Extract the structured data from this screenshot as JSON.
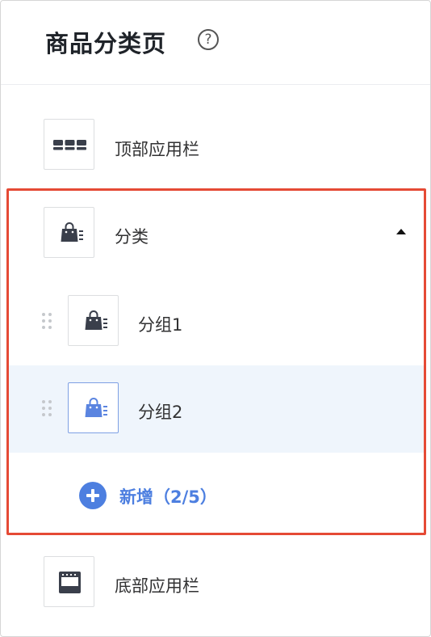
{
  "header": {
    "title": "商品分类页",
    "help_glyph": "?"
  },
  "components": {
    "top_bar": {
      "label": "顶部应用栏",
      "icon": "top-app-bar-icon"
    },
    "category": {
      "label": "分类",
      "icon": "shopping-bag-list-icon",
      "expanded": true
    },
    "groups": [
      {
        "label": "分组1",
        "icon": "shopping-bag-list-icon",
        "selected": false
      },
      {
        "label": "分组2",
        "icon": "shopping-bag-list-icon",
        "selected": true
      }
    ],
    "add_group": {
      "label": "新增（2/5）"
    },
    "bottom_bar": {
      "label": "底部应用栏",
      "icon": "bottom-app-bar-icon"
    }
  },
  "colors": {
    "accent": "#4d7fe0",
    "highlight_frame": "#e54a35",
    "selected_background": "#eff5fc",
    "icon_default": "#3a3f4b"
  }
}
